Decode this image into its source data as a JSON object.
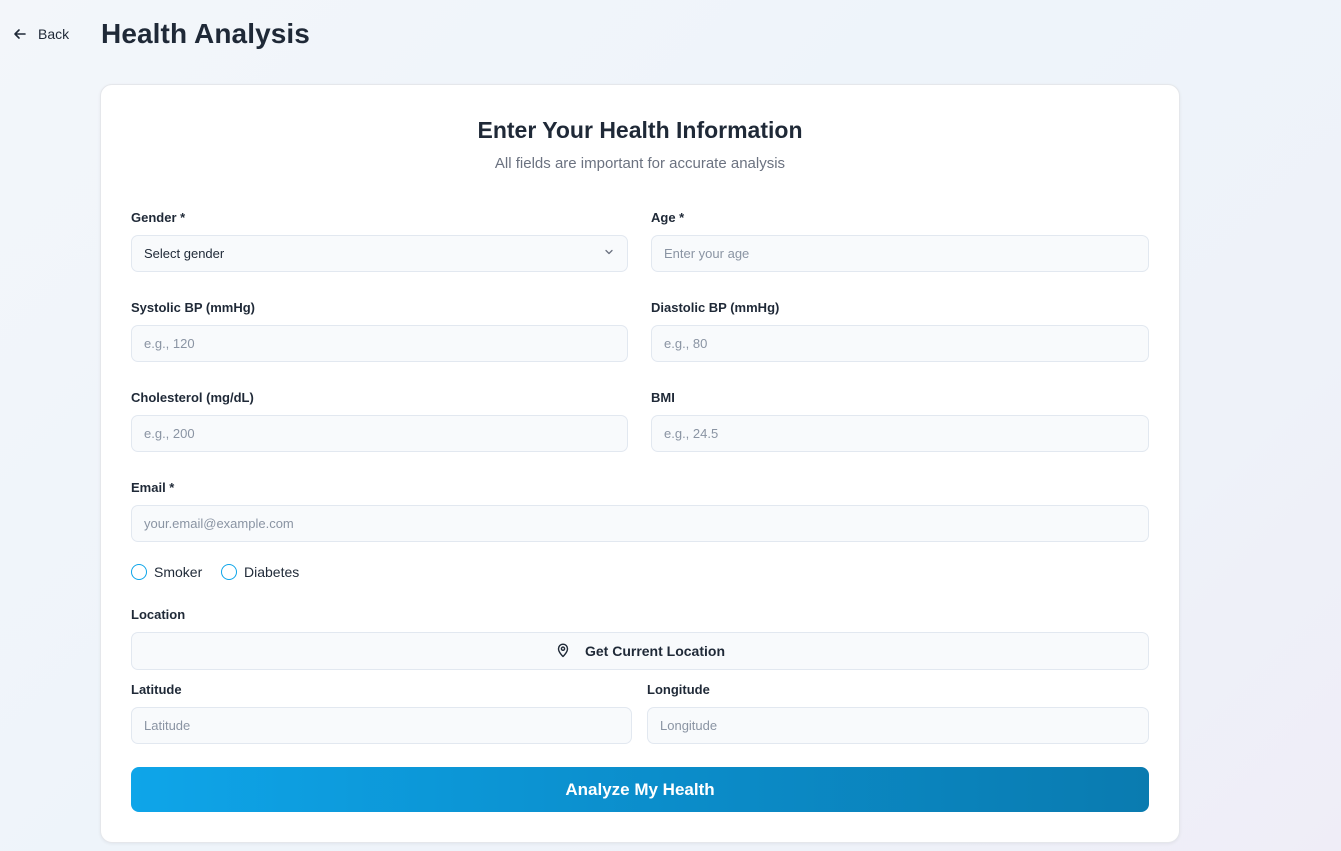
{
  "header": {
    "back_label": "Back",
    "title": "Health Analysis"
  },
  "form": {
    "title": "Enter Your Health Information",
    "subtitle": "All fields are important for accurate analysis",
    "gender": {
      "label": "Gender *",
      "value": "Select gender"
    },
    "age": {
      "label": "Age *",
      "placeholder": "Enter your age"
    },
    "systolic": {
      "label": "Systolic BP (mmHg)",
      "placeholder": "e.g., 120"
    },
    "diastolic": {
      "label": "Diastolic BP (mmHg)",
      "placeholder": "e.g., 80"
    },
    "cholesterol": {
      "label": "Cholesterol (mg/dL)",
      "placeholder": "e.g., 200"
    },
    "bmi": {
      "label": "BMI",
      "placeholder": "e.g., 24.5"
    },
    "email": {
      "label": "Email *",
      "placeholder": "your.email@example.com"
    },
    "smoker": {
      "label": "Smoker",
      "checked": false
    },
    "diabetes": {
      "label": "Diabetes",
      "checked": false
    },
    "location": {
      "label": "Location",
      "button_label": "Get Current Location",
      "icon": "map-pin-icon"
    },
    "latitude": {
      "label": "Latitude",
      "placeholder": "Latitude"
    },
    "longitude": {
      "label": "Longitude",
      "placeholder": "Longitude"
    },
    "submit_label": "Analyze My Health"
  },
  "colors": {
    "accent": "#0ea5e9",
    "accent_dark": "#0a7bb0",
    "text": "#1f2937",
    "muted": "#6b7280"
  }
}
